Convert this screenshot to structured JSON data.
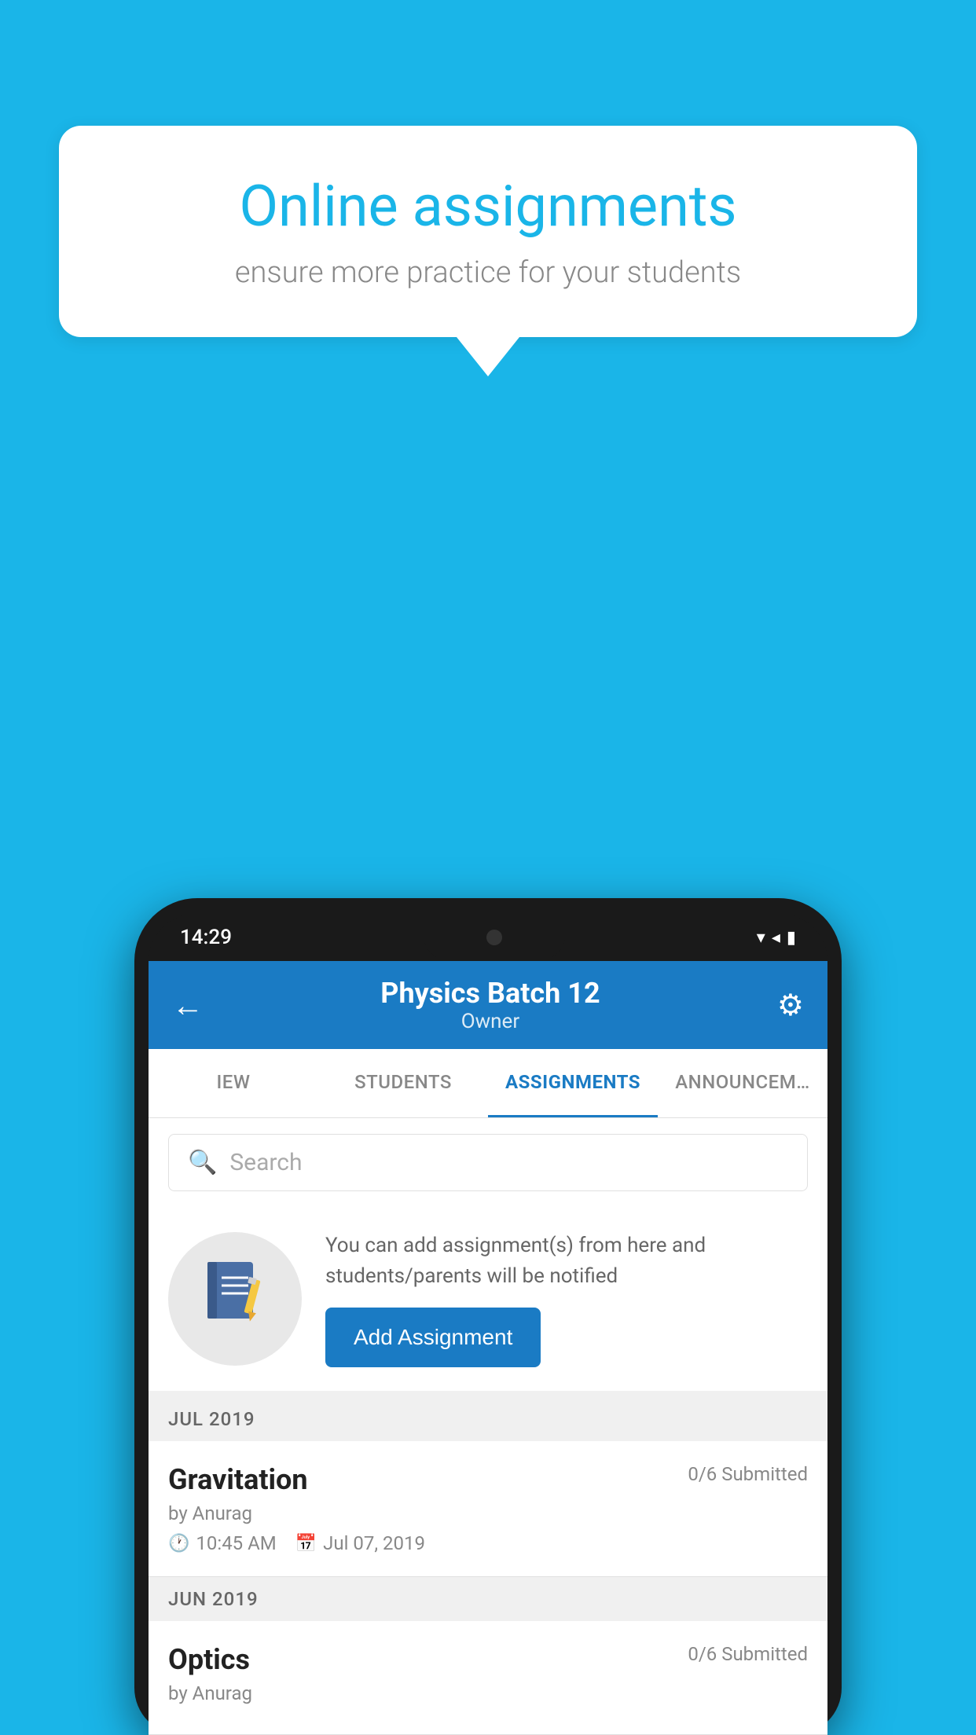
{
  "background_color": "#1ab5e8",
  "speech_bubble": {
    "title": "Online assignments",
    "subtitle": "ensure more practice for your students"
  },
  "status_bar": {
    "time": "14:29",
    "icons": [
      "▾",
      "◂",
      "▮"
    ]
  },
  "header": {
    "title": "Physics Batch 12",
    "subtitle": "Owner",
    "back_label": "←",
    "settings_label": "⚙"
  },
  "tabs": [
    {
      "label": "IEW",
      "active": false
    },
    {
      "label": "STUDENTS",
      "active": false
    },
    {
      "label": "ASSIGNMENTS",
      "active": true
    },
    {
      "label": "ANNOUNCEMENTS",
      "active": false
    }
  ],
  "search": {
    "placeholder": "Search"
  },
  "promo": {
    "text": "You can add assignment(s) from here and students/parents will be notified",
    "button_label": "Add Assignment"
  },
  "sections": [
    {
      "month": "JUL 2019",
      "assignments": [
        {
          "title": "Gravitation",
          "submitted": "0/6 Submitted",
          "author": "by Anurag",
          "time": "10:45 AM",
          "date": "Jul 07, 2019"
        }
      ]
    },
    {
      "month": "JUN 2019",
      "assignments": [
        {
          "title": "Optics",
          "submitted": "0/6 Submitted",
          "author": "by Anurag",
          "time": "",
          "date": ""
        }
      ]
    }
  ]
}
